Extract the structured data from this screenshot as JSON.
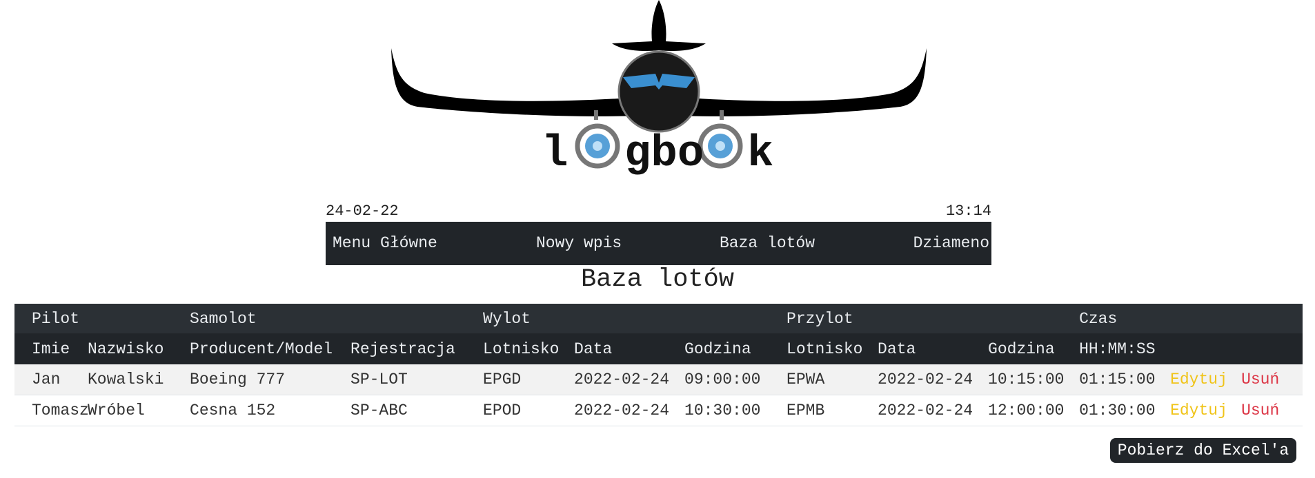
{
  "header": {
    "logo_text_parts": [
      "l",
      "gbo",
      "k"
    ],
    "date": "24-02-22",
    "time": "13:14"
  },
  "nav": {
    "items": [
      {
        "label": "Menu Główne"
      },
      {
        "label": "Nowy wpis"
      },
      {
        "label": "Baza lotów"
      },
      {
        "label": "Dziameno"
      }
    ]
  },
  "page_title": "Baza lotów",
  "table": {
    "group_headers": {
      "pilot": "Pilot",
      "plane": "Samolot",
      "departure": "Wylot",
      "arrival": "Przylot",
      "time": "Czas"
    },
    "columns": {
      "first_name": "Imie",
      "last_name": "Nazwisko",
      "model": "Producent/Model",
      "registration": "Rejestracja",
      "dep_airport": "Lotnisko",
      "dep_date": "Data",
      "dep_time": "Godzina",
      "arr_airport": "Lotnisko",
      "arr_date": "Data",
      "arr_time": "Godzina",
      "duration": "HH:MM:SS"
    },
    "rows": [
      {
        "first_name": "Jan",
        "last_name": "Kowalski",
        "model": "Boeing 777",
        "registration": "SP-LOT",
        "dep_airport": "EPGD",
        "dep_date": "2022-02-24",
        "dep_time": "09:00:00",
        "arr_airport": "EPWA",
        "arr_date": "2022-02-24",
        "arr_time": "10:15:00",
        "duration": "01:15:00",
        "edit_label": "Edytuj",
        "delete_label": "Usuń"
      },
      {
        "first_name": "Tomasz",
        "last_name": "Wróbel",
        "model": "Cesna 152",
        "registration": "SP-ABC",
        "dep_airport": "EPOD",
        "dep_date": "2022-02-24",
        "dep_time": "10:30:00",
        "arr_airport": "EPMB",
        "arr_date": "2022-02-24",
        "arr_time": "12:00:00",
        "duration": "01:30:00",
        "edit_label": "Edytuj",
        "delete_label": "Usuń"
      }
    ]
  },
  "export_button": "Pobierz do Excel'a",
  "colors": {
    "nav_bg": "#212529",
    "edit": "#f0c419",
    "delete": "#dc3545",
    "logo_blue": "#3a8fd0"
  }
}
